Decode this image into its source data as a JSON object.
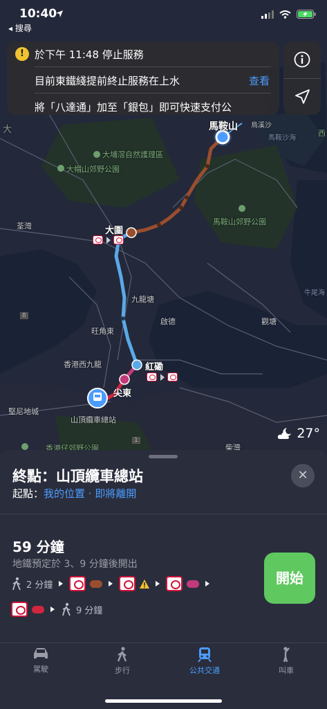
{
  "status_bar": {
    "time": "10:40",
    "back_app": "◂ 搜尋"
  },
  "banner": {
    "line1": "於下午 11:48 停止服務",
    "line2": "目前東鐵綫提前終止服務在上水",
    "line3": "將「八達通」加至「銀包」即可快速支付公",
    "view_label": "查看"
  },
  "map": {
    "labels": {
      "ma_on_shan": "馬鞍山",
      "wu_kai_sha": "烏溪沙",
      "tai_po_nature": "大埔滘自然護理區",
      "tai_mo_shan_park": "大帽山郊野公園",
      "ma_on_shan_park": "馬鞍山郊野公園",
      "tsuen_wan": "荃灣",
      "tai_wai": "大圍",
      "kowloon_tong": "九龍塘",
      "kai_tak": "啟德",
      "mong_kok_east": "旺角東",
      "kwun_tong": "觀塘",
      "hung_hom": "紅磡",
      "west_kowloon": "香港西九龍",
      "tsim_sha_tsui_east": "尖東",
      "kennedy_town": "堅尼地城",
      "peak_tram": "山頂纜車總站",
      "hk_trail_park": "香港仔郊野公園",
      "chai_wan": "柴灣",
      "ngau_chi_wan": "牛尾海",
      "sai_kung": "西",
      "tuen_mun_road": "大",
      "road8": "8",
      "road1": "1",
      "water_label": "馬鞍沙海"
    }
  },
  "weather": {
    "temperature": "27°"
  },
  "sheet": {
    "destination": "終點：山頂纜車總站",
    "origin_prefix": "起點：",
    "origin_value": "我的位置",
    "origin_dot": " · ",
    "origin_when": "即將離開",
    "duration": "59 分鐘",
    "departs": "地鐵預定於 3、9 分鐘後開出",
    "walk1": "2 分鐘",
    "walk2": "9 分鐘",
    "go_label": "開始"
  },
  "colors": {
    "east_rail_line": "#5aa9e6",
    "tuen_ma_line": "#9a4e2d",
    "tsuen_wan_line": "#c23a7a",
    "island_line": "#d0263f",
    "accent": "#4c9cff",
    "go_button": "#5fc85f"
  },
  "tabbar": {
    "tabs": [
      {
        "label": "駕駛",
        "icon": "car-icon"
      },
      {
        "label": "步行",
        "icon": "walk-icon"
      },
      {
        "label": "公共交通",
        "icon": "train-icon",
        "active": true
      },
      {
        "label": "叫車",
        "icon": "hail-icon"
      }
    ]
  }
}
